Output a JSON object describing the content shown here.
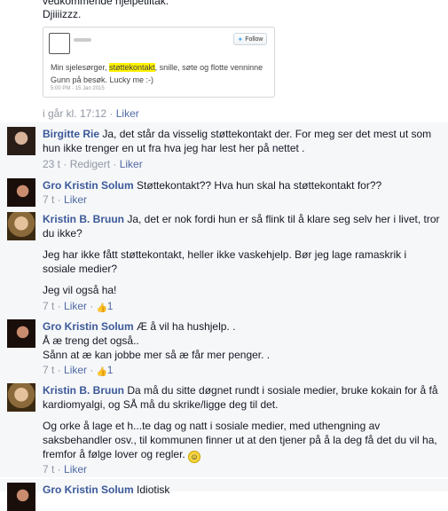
{
  "intro": {
    "line1": "vedkommende hjelpetiltak.",
    "line2": "Djiiiizzz."
  },
  "tweet": {
    "follow_label": "Follow",
    "text_before": "Min sjelesørger, ",
    "text_highlight": "støttekontakt",
    "text_after": ",  snille, søte og flotte venninne Gunn på besøk. Lucky me :-)",
    "timestamp": "5:00 PM - 15 Jan 2015"
  },
  "post_meta": {
    "time": "i går kl. 17:12",
    "sep": "·",
    "like": "Liker"
  },
  "comments": [
    {
      "author": "Birgitte Rie",
      "text": "Ja, det står da visselig støttekontakt der. For meg ser det mest ut som hun ikke trenger en ut fra hva jeg har lest her på nettet .",
      "time": "23 t",
      "edited": "Redigert",
      "like": "Liker"
    },
    {
      "author": "Gro Kristin Solum",
      "text": "Støttekontakt?? Hva hun skal ha støttekontakt for??",
      "time": "7 t",
      "like": "Liker"
    },
    {
      "author": "Kristin B. Bruun",
      "p1": "Ja, det er nok fordi hun er så flink til å klare seg selv her i livet, tror du ikke?",
      "p2": "Jeg har ikke fått støttekontakt, heller ikke vaskehjelp. Bør jeg lage ramaskrik i sosiale medier?",
      "p3": "Jeg vil også ha!",
      "time": "7 t",
      "like": "Liker",
      "likes_count": "1"
    },
    {
      "author": "Gro Kristin Solum",
      "l1": "Æ å vil ha hushjelp. .",
      "l2": "Å æ treng det også..",
      "l3": "Sånn at æ kan jobbe mer så æ får mer penger. .",
      "time": "7 t",
      "like": "Liker",
      "likes_count": "1"
    },
    {
      "author": "Kristin B. Bruun",
      "p1": "Da må du sitte døgnet rundt i sosiale medier, bruke kokain for å få kardiomyalgi, og SÅ må du skrike/ligge deg til det.",
      "p2": "Og orke å lage et h...te dag og natt i sosiale medier, med uthengning av saksbehandler osv., til kommunen finner ut at den tjener på å la deg få det du vil ha, fremfor å følge lover og regler.",
      "time": "7 t",
      "like": "Liker"
    },
    {
      "author": "Gro Kristin Solum",
      "text": "Idiotisk"
    }
  ]
}
